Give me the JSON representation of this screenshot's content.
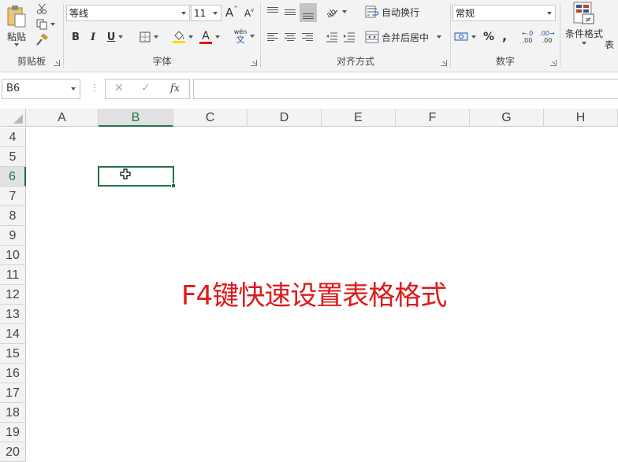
{
  "ribbon": {
    "clipboard": {
      "paste_label": "粘贴",
      "group_label": "剪贴板"
    },
    "font": {
      "font_name": "等线",
      "font_size": "11",
      "grow_glyph": "A",
      "shrink_glyph": "A",
      "bold": "B",
      "italic": "I",
      "underline": "U",
      "font_color_glyph": "A",
      "phonetic_top": "wén",
      "phonetic_bottom": "文",
      "group_label": "字体"
    },
    "alignment": {
      "wrap_text_label": "自动换行",
      "merge_center_label": "合并后居中",
      "group_label": "对齐方式"
    },
    "number": {
      "format": "常规",
      "percent": "%",
      "comma": ",",
      "inc_decimal": ".00",
      "dec_decimal": ".00",
      "inc_decimal_top": "←.0",
      "dec_decimal_top": ".00→",
      "group_label": "数字"
    },
    "styles": {
      "conditional_format_label": "条件格式",
      "table_format_label": "表",
      "cond_icon_glyph": "≠"
    }
  },
  "formula_bar": {
    "name_box": "B6",
    "cancel_glyph": "✕",
    "enter_glyph": "✓",
    "fx_glyph": "fx",
    "dots_glyph": "⋮",
    "formula": ""
  },
  "sheet": {
    "columns": [
      "A",
      "B",
      "C",
      "D",
      "E",
      "F",
      "G",
      "H"
    ],
    "rows": [
      "4",
      "5",
      "6",
      "7",
      "8",
      "9",
      "10",
      "11",
      "12",
      "13",
      "14",
      "15",
      "16",
      "17",
      "18",
      "19",
      "20"
    ],
    "active_cell": "B6",
    "active_column": "B",
    "active_row": "6",
    "accent_color": "#217346"
  },
  "overlay": {
    "caption": "F4键快速设置表格格式",
    "color": "#e0191b"
  }
}
